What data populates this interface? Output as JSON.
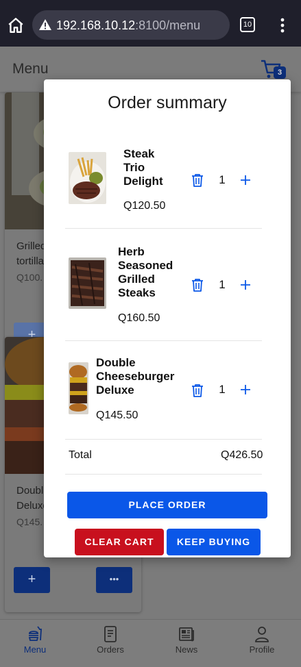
{
  "browser": {
    "url_host": "192.168.10.12",
    "url_path": ":8100/menu",
    "tab_count": "10"
  },
  "app": {
    "title": "Menu",
    "cart_count": "3"
  },
  "background_cards": [
    {
      "name": "Grilled ... tortilla...",
      "name_line1": "Grilled",
      "name_line2": "tortilla",
      "price": "Q100.",
      "add_label": "+"
    },
    {
      "name_line1": "Doubl",
      "name_line2": "Deluxe",
      "price": "Q145.",
      "add_label": "+",
      "more_label": "•••"
    }
  ],
  "modal": {
    "title": "Order summary",
    "items": [
      {
        "name": "Steak Trio Delight",
        "name_lines": [
          "Steak",
          "Trio",
          "Delight"
        ],
        "price": "Q120.50",
        "qty": "1"
      },
      {
        "name": "Herb Seasoned Grilled Steaks",
        "name_lines": [
          "Herb",
          "Seasoned",
          "Grilled",
          "Steaks"
        ],
        "price": "Q160.50",
        "qty": "1"
      },
      {
        "name": "Double Cheeseburger Deluxe",
        "name_lines": [
          "Double",
          "Cheeseburger",
          "Deluxe"
        ],
        "price": "Q145.50",
        "qty": "1"
      }
    ],
    "total_label": "Total",
    "total_value": "Q426.50",
    "place_order": "PLACE ORDER",
    "clear_cart": "CLEAR CART",
    "keep_buying": "KEEP BUYING"
  },
  "nav": {
    "items": [
      {
        "label": "Menu",
        "icon": "fastfood-icon",
        "active": true
      },
      {
        "label": "Orders",
        "icon": "receipt-icon",
        "active": false
      },
      {
        "label": "News",
        "icon": "newspaper-icon",
        "active": false
      },
      {
        "label": "Profile",
        "icon": "person-icon",
        "active": false
      }
    ]
  },
  "colors": {
    "primary": "#0a57e8",
    "danger": "#c8101e",
    "badge": "#0d2f7a"
  }
}
